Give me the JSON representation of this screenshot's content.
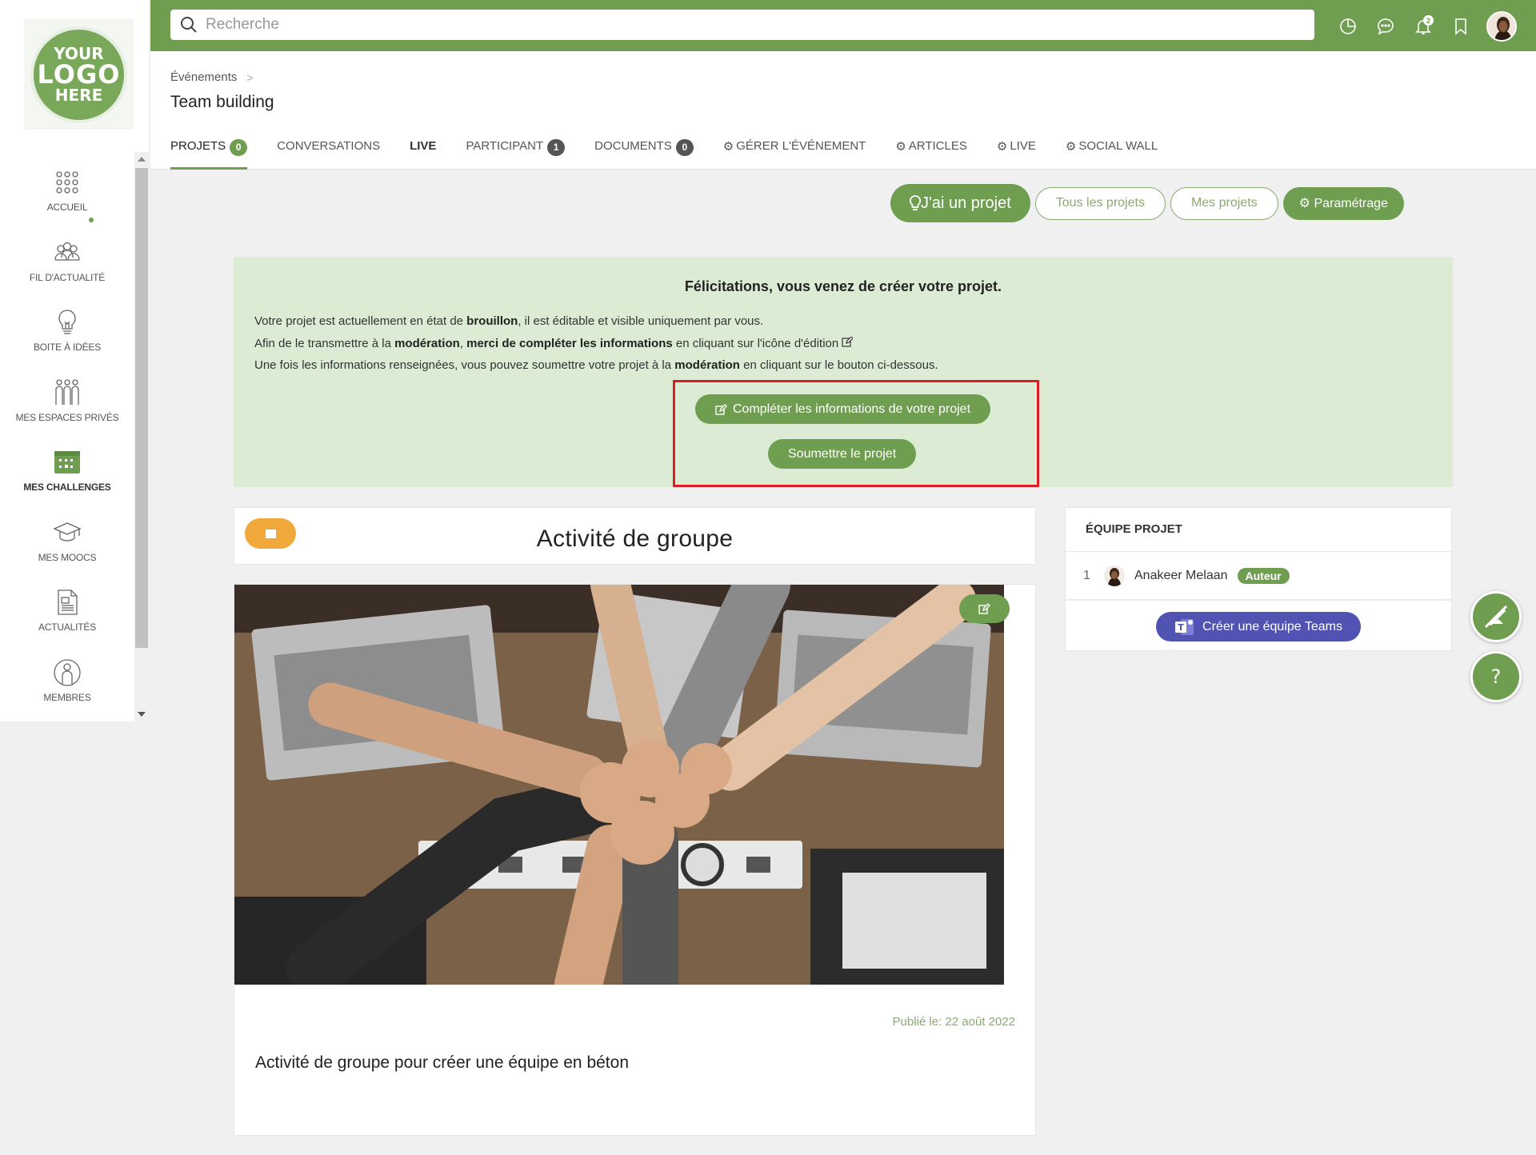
{
  "logo": {
    "line1": "YOUR",
    "line2": "LOGO",
    "line3": "HERE"
  },
  "search": {
    "placeholder": "Recherche"
  },
  "topbar": {
    "notification_count": "2"
  },
  "sidebar": {
    "items": [
      {
        "label": "ACCUEIL",
        "icon": "grid-dots-icon"
      },
      {
        "label": "FIL D'ACTUALITÉ",
        "icon": "people-feed-icon"
      },
      {
        "label": "BOITE À IDÉES",
        "icon": "lightbulb-icon"
      },
      {
        "label": "MES ESPACES PRIVÉS",
        "icon": "group-icon"
      },
      {
        "label": "MES CHALLENGES",
        "icon": "calendar-icon",
        "active": true
      },
      {
        "label": "MES MOOCS",
        "icon": "graduation-cap-icon"
      },
      {
        "label": "ACTUALITÉS",
        "icon": "newspaper-icon"
      },
      {
        "label": "MEMBRES",
        "icon": "member-icon"
      }
    ]
  },
  "breadcrumb": {
    "parent": "Événements",
    "separator": ">"
  },
  "page_title": "Team building",
  "tabs": [
    {
      "label": "PROJETS",
      "count": "0"
    },
    {
      "label": "CONVERSATIONS"
    },
    {
      "label": "LIVE"
    },
    {
      "label": "PARTICIPANT",
      "count": "1"
    },
    {
      "label": "DOCUMENTS",
      "count": "0"
    },
    {
      "label": "GÉRER L'ÉVÉNEMENT"
    },
    {
      "label": "ARTICLES"
    },
    {
      "label": "LIVE"
    },
    {
      "label": "SOCIAL WALL"
    }
  ],
  "actions": {
    "new_project": "J'ai un projet",
    "all_projects": "Tous les projets",
    "my_projects": "Mes projets",
    "settings": "Paramétrage"
  },
  "success": {
    "title": "Félicitations, vous venez de créer votre projet.",
    "line1_a": "Votre projet est actuellement en état de ",
    "line1_b": "brouillon",
    "line1_c": ", il est éditable et visible uniquement par vous.",
    "line2_a": "Afin de le transmettre à la ",
    "line2_b": "modération",
    "line2_c": ", ",
    "line2_d": "merci de compléter les informations",
    "line2_e": " en cliquant sur l'icône d'édition",
    "line3_a": "Une fois les informations renseignées, vous pouvez soumettre votre projet à la ",
    "line3_b": "modération",
    "line3_c": " en cliquant sur le bouton ci-dessous.",
    "complete_button": "Compléter les informations de votre projet",
    "submit_button": "Soumettre le projet"
  },
  "project": {
    "title": "Activité de groupe",
    "published": "Publié le: 22 août 2022",
    "description": "Activité de groupe pour créer une équipe en béton"
  },
  "team": {
    "title": "ÉQUIPE PROJET",
    "member_index": "1",
    "member_name": "Anakeer Melaan",
    "member_role": "Auteur",
    "teams_button": "Créer une équipe Teams"
  },
  "fab": {
    "help": "?"
  },
  "colors": {
    "brand": "#6f9e51",
    "success_bg": "#dcecd4",
    "teams": "#5153b3",
    "tag": "#f0a93a",
    "highlight": "#e01b24"
  }
}
